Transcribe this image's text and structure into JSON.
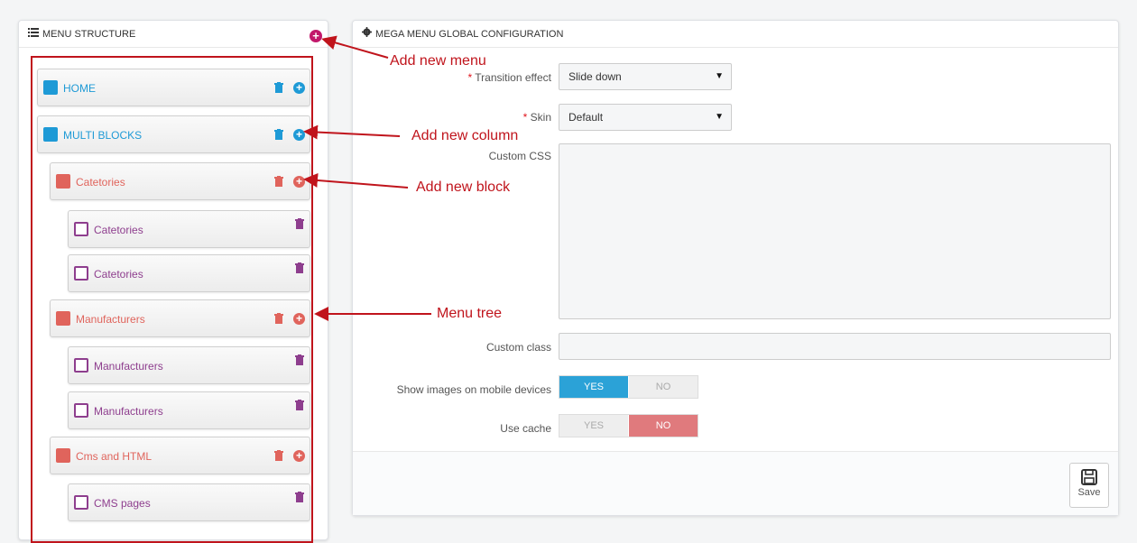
{
  "left_panel": {
    "title": "MENU STRUCTURE",
    "add_button": "+",
    "nodes": [
      {
        "label": "HOME",
        "kind": "menu",
        "color": "#1e9ad6"
      },
      {
        "label": "MULTI BLOCKS",
        "kind": "menu",
        "color": "#1e9ad6"
      },
      {
        "label": "Catetories",
        "kind": "column",
        "color": "#e0645c"
      },
      {
        "label": "Catetories",
        "kind": "block",
        "color": "#8e3e8e"
      },
      {
        "label": "Catetories",
        "kind": "block",
        "color": "#8e3e8e"
      },
      {
        "label": "Manufacturers",
        "kind": "column",
        "color": "#e0645c"
      },
      {
        "label": "Manufacturers",
        "kind": "block",
        "color": "#8e3e8e"
      },
      {
        "label": "Manufacturers",
        "kind": "block",
        "color": "#8e3e8e"
      },
      {
        "label": "Cms and HTML",
        "kind": "column",
        "color": "#e0645c"
      },
      {
        "label": "CMS pages",
        "kind": "block",
        "color": "#8e3e8e"
      }
    ]
  },
  "right_panel": {
    "title": "MEGA MENU GLOBAL CONFIGURATION",
    "fields": {
      "transition_label": "Transition effect",
      "transition_value": "Slide down",
      "skin_label": "Skin",
      "skin_value": "Default",
      "css_label": "Custom CSS",
      "class_label": "Custom class",
      "mobile_images_label": "Show images on mobile devices",
      "use_cache_label": "Use cache",
      "yes": "YES",
      "no": "NO",
      "required_mark": "*"
    },
    "save_label": "Save"
  },
  "annotations": {
    "add_menu": "Add new menu",
    "add_column": "Add new column",
    "add_block": "Add new block",
    "menu_tree": "Menu tree"
  },
  "colors": {
    "accent_blue": "#1e9ad6",
    "column_red": "#e0645c",
    "block_purple": "#8e3e8e",
    "annotation_red": "#c0141c",
    "toggle_yes_active": "#2ba2d7",
    "toggle_no_active": "#e07a7d"
  }
}
